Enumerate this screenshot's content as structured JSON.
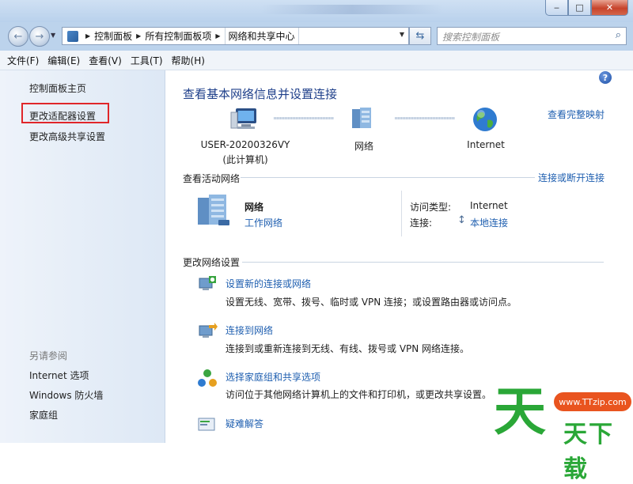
{
  "breadcrumb": [
    "控制面板",
    "所有控制面板项",
    "网络和共享中心"
  ],
  "search": {
    "placeholder": "搜索控制面板"
  },
  "menu": [
    "文件(F)",
    "编辑(E)",
    "查看(V)",
    "工具(T)",
    "帮助(H)"
  ],
  "sidebar": {
    "items": [
      "控制面板主页",
      "更改适配器设置",
      "更改高级共享设置"
    ],
    "see_also_label": "另请参阅",
    "see_also": [
      "Internet 选项",
      "Windows 防火墙",
      "家庭组"
    ]
  },
  "main": {
    "title": "查看基本网络信息并设置连接",
    "full_map_link": "查看完整映射",
    "map": {
      "computer_name": "USER-20200326VY",
      "computer_sub": "(此计算机)",
      "network": "网络",
      "internet": "Internet"
    },
    "active_networks": {
      "heading": "查看活动网络",
      "connect_link": "连接或断开连接",
      "network_name": "网络",
      "network_type": "工作网络",
      "access_type_label": "访问类型:",
      "access_type_value": "Internet",
      "connection_label": "连接:",
      "connection_value": "本地连接"
    },
    "change_settings": {
      "heading": "更改网络设置",
      "tasks": [
        {
          "title": "设置新的连接或网络",
          "desc": "设置无线、宽带、拨号、临时或 VPN 连接；或设置路由器或访问点。"
        },
        {
          "title": "连接到网络",
          "desc": "连接到或重新连接到无线、有线、拨号或 VPN 网络连接。"
        },
        {
          "title": "选择家庭组和共享选项",
          "desc": "访问位于其他网络计算机上的文件和打印机，或更改共享设置。"
        },
        {
          "title": "疑难解答",
          "desc": ""
        }
      ]
    }
  },
  "watermark": {
    "big": "天",
    "url": "www.TTzip.com",
    "small": "天下载"
  },
  "colors": {
    "link": "#1f5fb0",
    "title": "#1e3f8a",
    "highlight_box": "#e0262a",
    "watermark_green": "#2aa737",
    "watermark_orange": "#e9541f"
  }
}
